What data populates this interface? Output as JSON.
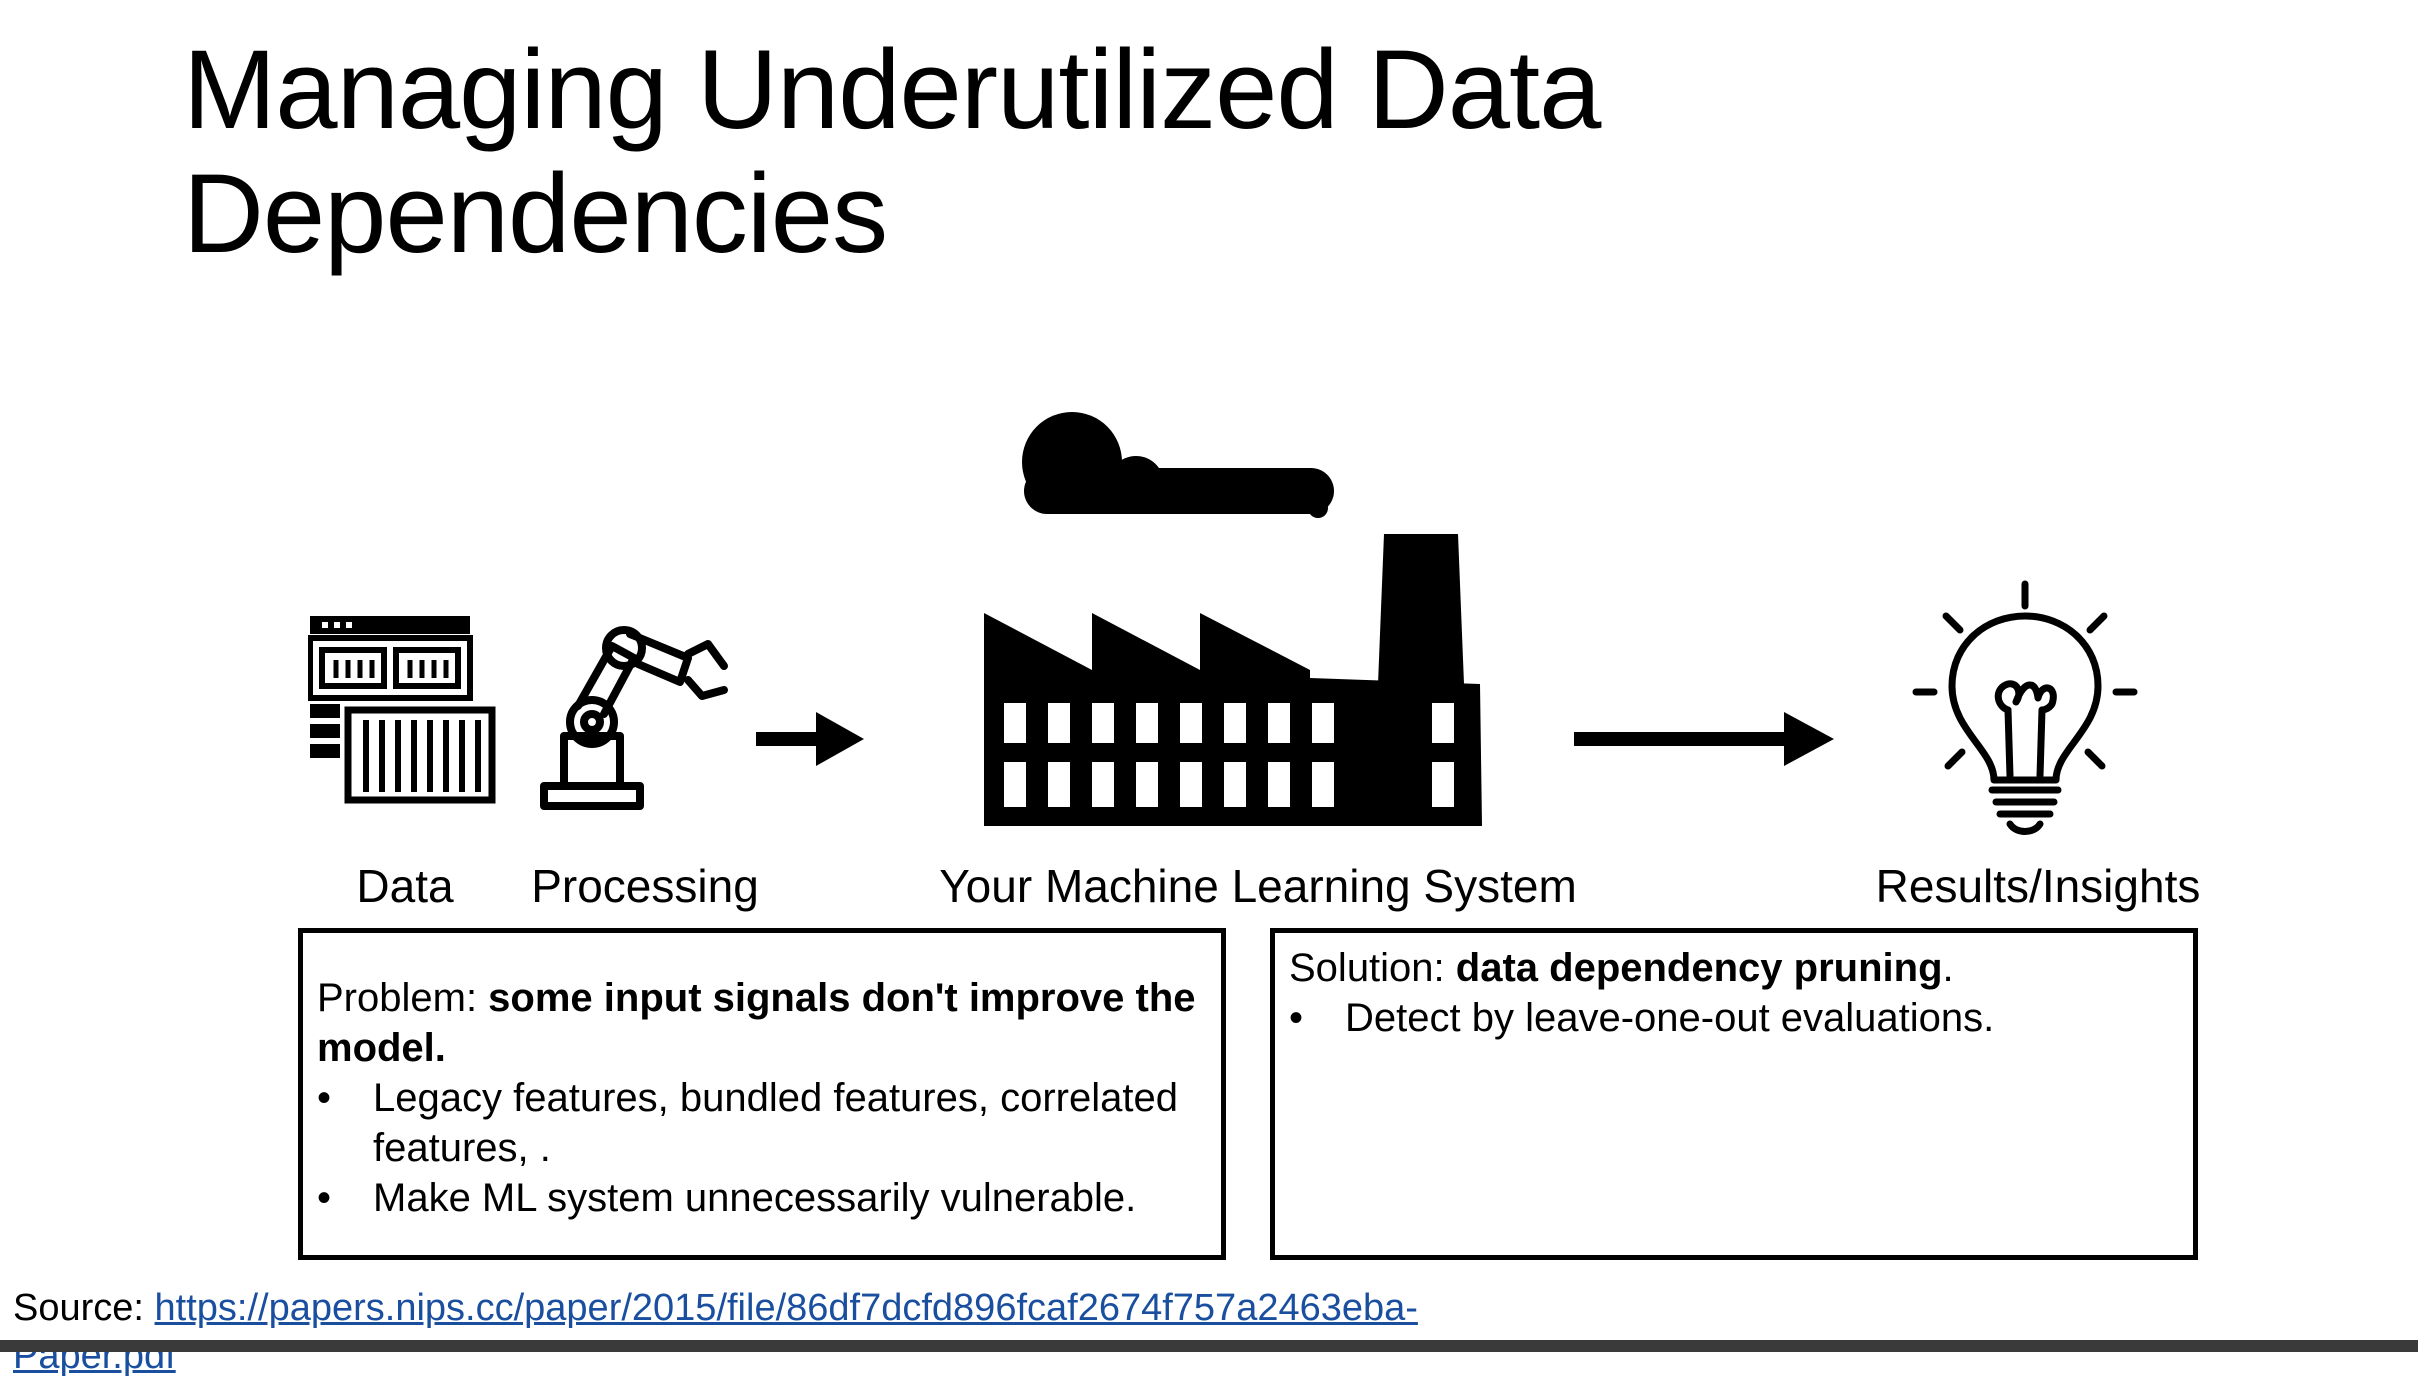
{
  "slide": {
    "title": "Managing Underutilized Data Dependencies"
  },
  "pipeline": {
    "labels": {
      "data": "Data",
      "processing": "Processing",
      "ml_system": "Your Machine Learning System",
      "results": "Results/Insights"
    },
    "icons": [
      "server-rack-icon",
      "robotic-arm-icon",
      "arrow-right-icon",
      "factory-icon",
      "arrow-right-icon",
      "lightbulb-icon"
    ]
  },
  "problem": {
    "prefix": "Problem: ",
    "bold": "some input signals don't improve the model.",
    "bullets": [
      "Legacy features, bundled features, correlated features, .",
      "Make ML system unnecessarily vulnerable."
    ]
  },
  "solution": {
    "prefix": "Solution: ",
    "bold": "data dependency pruning",
    "suffix": ".",
    "bullets": [
      "Detect by leave-one-out evaluations."
    ]
  },
  "source": {
    "label": "Source: ",
    "link_line1": "https://papers.nips.cc/paper/2015/file/86df7dcfd896fcaf2674f757a2463eba-",
    "link_line2": "Paper.pdf"
  }
}
